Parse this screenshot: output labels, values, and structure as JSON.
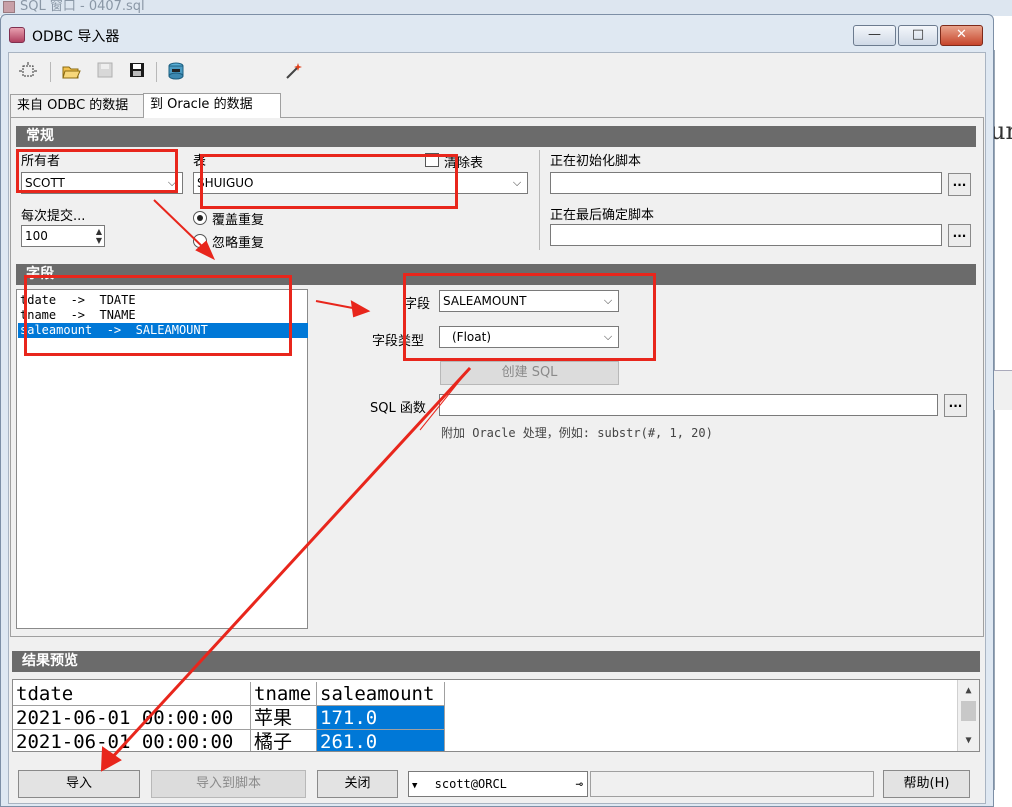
{
  "background_window": {
    "title": "SQL 窗口 - 0407.sql",
    "right_text": "ur"
  },
  "dialog": {
    "title": "ODBC 导入器",
    "caption_buttons": {
      "minimize": "—",
      "maximize": "□",
      "close": "✕"
    }
  },
  "toolbar": {
    "icons": [
      "new-icon",
      "open-folder-icon",
      "save-disabled-icon",
      "save-icon",
      "database-icon",
      "magic-wand-icon"
    ]
  },
  "tabs": [
    {
      "label": "来自 ODBC 的数据",
      "active": false
    },
    {
      "label": "到 Oracle 的数据",
      "active": true
    }
  ],
  "general": {
    "header": "常规",
    "owner_label": "所有者",
    "owner_value": "SCOTT",
    "table_label": "表",
    "table_value": "SHUIGUO",
    "truncate_label": "清除表",
    "commit_label": "每次提交...",
    "commit_value": "100",
    "radio_overwrite": "覆盖重复",
    "radio_ignore": "忽略重复",
    "init_script_label": "正在初始化脚本",
    "final_script_label": "正在最后确定脚本",
    "dots": "..."
  },
  "fields": {
    "header": "字段",
    "mappings": [
      "tdate  ->  TDATE",
      "tname  ->  TNAME",
      "saleamount  ->  SALEAMOUNT"
    ],
    "selected_index": 2,
    "field_label": "字段",
    "field_value": "SALEAMOUNT",
    "type_label": "字段类型",
    "type_value": "(Float)",
    "create_sql_label": "创建 SQL",
    "sql_func_label": "SQL 函数",
    "sql_func_value": "",
    "hint": "附加 Oracle 处理，例如: substr(#, 1, 20)"
  },
  "preview": {
    "header": "结果预览",
    "columns": [
      "tdate",
      "tname",
      "saleamount"
    ],
    "rows": [
      [
        "2021-06-01 00:00:00",
        "苹果",
        "171.0"
      ],
      [
        "2021-06-01 00:00:00",
        "橘子",
        "261.0"
      ]
    ]
  },
  "footer": {
    "import_label": "导入",
    "import_to_script_label": "导入到脚本",
    "close_label": "关闭",
    "connection": "scott@ORCL",
    "help_label": "帮助(H)"
  },
  "colors": {
    "selection": "#0078d7",
    "annotation_red": "#e8261c",
    "section_header": "#6b6b6b"
  }
}
